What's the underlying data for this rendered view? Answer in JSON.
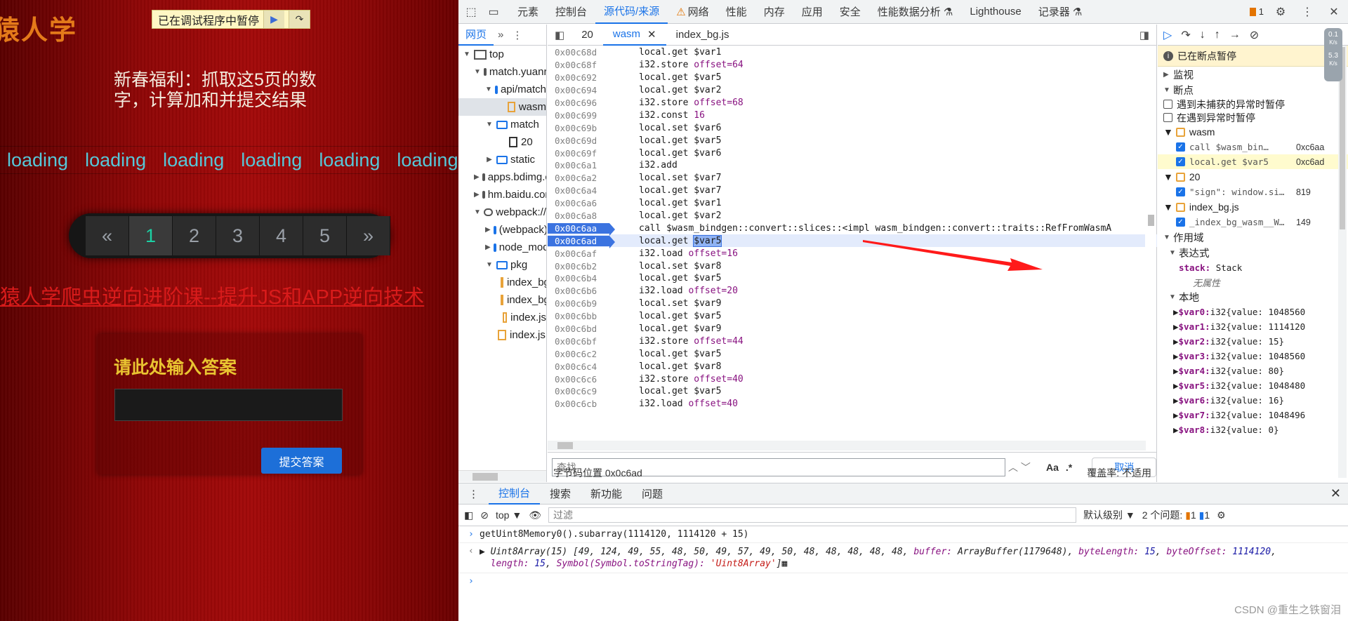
{
  "webpage": {
    "site_logo": "猿人学",
    "pause_banner": "已在调试程序中暂停",
    "welfare_text": "新春福利：抓取这5页的数字，计算加和并提交结果",
    "loading_items": [
      "loading",
      "loading",
      "loading",
      "loading",
      "loading",
      "loading"
    ],
    "pager": [
      "«",
      "1",
      "2",
      "3",
      "4",
      "5",
      "»"
    ],
    "pager_active": "1",
    "course_link": "猿人学爬虫逆向进阶课--提升JS和APP逆向技术",
    "answer_title": "请此处输入答案",
    "answer_value": "",
    "submit_label": "提交答案"
  },
  "devtools": {
    "main_tabs": [
      "元素",
      "控制台",
      "源代码/来源",
      "网络",
      "性能",
      "内存",
      "应用",
      "安全",
      "性能数据分析 ⚗",
      "Lighthouse",
      "记录器 ⚗"
    ],
    "active_tab": "源代码/来源",
    "issue_count": "1",
    "navigator": {
      "tab": "网页",
      "tree": [
        {
          "label": "top",
          "depth": 0,
          "kind": "frame",
          "open": true
        },
        {
          "label": "match.yuanrenxue",
          "depth": 1,
          "kind": "cloud",
          "open": true
        },
        {
          "label": "api/match",
          "depth": 2,
          "kind": "folder",
          "open": true
        },
        {
          "label": "wasm",
          "depth": 3,
          "kind": "file",
          "selected": true
        },
        {
          "label": "match",
          "depth": 2,
          "kind": "folder",
          "open": true
        },
        {
          "label": "20",
          "depth": 3,
          "kind": "plainfile"
        },
        {
          "label": "static",
          "depth": 2,
          "kind": "folder",
          "open": false
        },
        {
          "label": "apps.bdimg.com",
          "depth": 1,
          "kind": "cloud",
          "open": false
        },
        {
          "label": "hm.baidu.com",
          "depth": 1,
          "kind": "cloud",
          "open": false
        },
        {
          "label": "webpack://",
          "depth": 1,
          "kind": "cloud",
          "open": true
        },
        {
          "label": "(webpack)",
          "depth": 2,
          "kind": "folder",
          "open": false
        },
        {
          "label": "node_modules",
          "depth": 2,
          "kind": "folder",
          "open": false
        },
        {
          "label": "pkg",
          "depth": 2,
          "kind": "folder",
          "open": true
        },
        {
          "label": "index_bg.js",
          "depth": 3,
          "kind": "file"
        },
        {
          "label": "index_bg.wasm",
          "depth": 3,
          "kind": "file"
        },
        {
          "label": "index.js",
          "depth": 3,
          "kind": "file"
        },
        {
          "label": "index.js",
          "depth": 2,
          "kind": "file"
        }
      ]
    },
    "editor": {
      "num_tab": "20",
      "file_tabs": [
        {
          "label": "wasm",
          "active": true,
          "closable": true
        },
        {
          "label": "index_bg.js",
          "active": false,
          "closable": false
        }
      ],
      "lines": [
        {
          "addr": "0x00c68d",
          "op": "local.get",
          "arg": "$var1"
        },
        {
          "addr": "0x00c68f",
          "op": "i32.store",
          "arg": "offset=64"
        },
        {
          "addr": "0x00c692",
          "op": "local.get",
          "arg": "$var5"
        },
        {
          "addr": "0x00c694",
          "op": "local.get",
          "arg": "$var2"
        },
        {
          "addr": "0x00c696",
          "op": "i32.store",
          "arg": "offset=68"
        },
        {
          "addr": "0x00c699",
          "op": "i32.const",
          "arg": "16"
        },
        {
          "addr": "0x00c69b",
          "op": "local.set",
          "arg": "$var6"
        },
        {
          "addr": "0x00c69d",
          "op": "local.get",
          "arg": "$var5"
        },
        {
          "addr": "0x00c69f",
          "op": "local.get",
          "arg": "$var6"
        },
        {
          "addr": "0x00c6a1",
          "op": "i32.add",
          "arg": ""
        },
        {
          "addr": "0x00c6a2",
          "op": "local.set",
          "arg": "$var7"
        },
        {
          "addr": "0x00c6a4",
          "op": "local.get",
          "arg": "$var7"
        },
        {
          "addr": "0x00c6a6",
          "op": "local.get",
          "arg": "$var1"
        },
        {
          "addr": "0x00c6a8",
          "op": "local.get",
          "arg": "$var2"
        },
        {
          "addr": "0x00c6aa",
          "op": "call",
          "arg": "$wasm_bindgen::convert::slices::<impl wasm_bindgen::convert::traits::RefFromWasmA",
          "bp": true
        },
        {
          "addr": "0x00c6ad",
          "op": "local.get",
          "arg": "$var5",
          "bp": true,
          "current": true
        },
        {
          "addr": "0x00c6af",
          "op": "i32.load",
          "arg": "offset=16"
        },
        {
          "addr": "0x00c6b2",
          "op": "local.set",
          "arg": "$var8"
        },
        {
          "addr": "0x00c6b4",
          "op": "local.get",
          "arg": "$var5"
        },
        {
          "addr": "0x00c6b6",
          "op": "i32.load",
          "arg": "offset=20"
        },
        {
          "addr": "0x00c6b9",
          "op": "local.set",
          "arg": "$var9"
        },
        {
          "addr": "0x00c6bb",
          "op": "local.get",
          "arg": "$var5"
        },
        {
          "addr": "0x00c6bd",
          "op": "local.get",
          "arg": "$var9"
        },
        {
          "addr": "0x00c6bf",
          "op": "i32.store",
          "arg": "offset=44"
        },
        {
          "addr": "0x00c6c2",
          "op": "local.get",
          "arg": "$var5"
        },
        {
          "addr": "0x00c6c4",
          "op": "local.get",
          "arg": "$var8"
        },
        {
          "addr": "0x00c6c6",
          "op": "i32.store",
          "arg": "offset=40"
        },
        {
          "addr": "0x00c6c9",
          "op": "local.get",
          "arg": "$var5"
        },
        {
          "addr": "0x00c6cb",
          "op": "i32.load",
          "arg": "offset=40"
        }
      ],
      "find_placeholder": "查找",
      "find_case": "Aa",
      "find_regex": ".*",
      "cancel_label": "取消",
      "bytecode_position": "字节码位置 0x0c6ad",
      "coverage": "覆盖率: 不适用"
    },
    "debugger": {
      "paused_text": "已在断点暂停",
      "watch": "监视",
      "breakpoints": "断点",
      "pause_uncaught": "遇到未捕获的异常时暂停",
      "pause_caught": "在遇到异常时暂停",
      "bp_groups": [
        {
          "file": "wasm",
          "items": [
            {
              "code": "call $wasm_bin…",
              "line": "0xc6aa",
              "current": false
            },
            {
              "code": "local.get $var5",
              "line": "0xc6ad",
              "current": true
            }
          ]
        },
        {
          "file": "20",
          "items": [
            {
              "code": "\"sign\": window.si…",
              "line": "819",
              "current": false
            }
          ]
        },
        {
          "file": "index_bg.js",
          "items": [
            {
              "code": "_index_bg_wasm__W…",
              "line": "149",
              "current": false
            }
          ]
        }
      ],
      "scope": "作用域",
      "expression": "表达式",
      "stack_key": "stack:",
      "stack_val": "Stack",
      "no_props": "无属性",
      "local": "本地",
      "locals": [
        {
          "name": "$var0:",
          "type": "i32",
          "value": "{value: 1048560"
        },
        {
          "name": "$var1:",
          "type": "i32",
          "value": "{value: 1114120"
        },
        {
          "name": "$var2:",
          "type": "i32",
          "value": "{value: 15}"
        },
        {
          "name": "$var3:",
          "type": "i32",
          "value": "{value: 1048560"
        },
        {
          "name": "$var4:",
          "type": "i32",
          "value": "{value: 80}"
        },
        {
          "name": "$var5:",
          "type": "i32",
          "value": "{value: 1048480"
        },
        {
          "name": "$var6:",
          "type": "i32",
          "value": "{value: 16}"
        },
        {
          "name": "$var7:",
          "type": "i32",
          "value": "{value: 1048496"
        },
        {
          "name": "$var8:",
          "type": "i32",
          "value": "{value: 0}"
        }
      ],
      "net_up": "0.1",
      "net_up_unit": "K/s",
      "net_down": "5.3",
      "net_down_unit": "K/s"
    },
    "drawer": {
      "tabs": [
        "控制台",
        "搜索",
        "新功能",
        "问题"
      ],
      "active": "控制台",
      "context": "top",
      "filter_placeholder": "过滤",
      "level": "默认级别",
      "issues": "2 个问题:",
      "issue_warn": "1",
      "issue_info": "1",
      "input_line": "getUint8Memory0().subarray(1114120, 1114120 + 15)",
      "output_head": "Uint8Array(15) [49, 124, 49, 55, 48, 50, 49, 57, 49, 50, 48, 48, 48, 48, 48, ",
      "output_buffer_key": "buffer:",
      "output_buffer_val": "ArrayBuffer(1179648)",
      "output_bytelen_key": "byteLength:",
      "output_bytelen_val": "15",
      "output_byteoff_key": "byteOffset:",
      "output_byteoff_val": "1114120",
      "output_len_key": "length:",
      "output_len_val": "15",
      "output_tag_key": "Symbol(Symbol.toStringTag):",
      "output_tag_val": "'Uint8Array'"
    }
  },
  "watermark": "CSDN @重生之铁窗泪"
}
